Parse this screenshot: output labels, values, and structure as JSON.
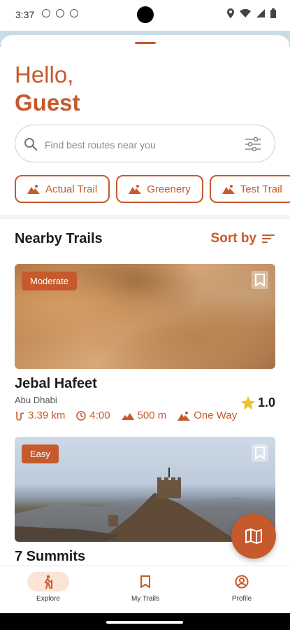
{
  "status_bar": {
    "time": "3:37"
  },
  "greeting": {
    "hello": "Hello,",
    "name": "Guest"
  },
  "search": {
    "placeholder": "Find best routes near you"
  },
  "chips": [
    {
      "label": "Actual Trail"
    },
    {
      "label": "Greenery"
    },
    {
      "label": "Test Trail"
    }
  ],
  "section": {
    "title": "Nearby Trails",
    "sort_label": "Sort by"
  },
  "trails": [
    {
      "badge": "Moderate",
      "name": "Jebal Hafeet",
      "location": "Abu Dhabi",
      "rating": "1.0",
      "distance": "3.39 km",
      "duration": "4:00",
      "elevation": "500 m",
      "route_type": "One Way"
    },
    {
      "badge": "Easy",
      "name": "7 Summits"
    }
  ],
  "nav": {
    "explore": "Explore",
    "my_trails": "My Trails",
    "profile": "Profile"
  },
  "colors": {
    "accent": "#c65a2c",
    "star": "#f2c230",
    "active_pill": "#fbe3d6"
  },
  "icons": [
    "search-icon",
    "filter-icon",
    "mountain-icon",
    "sort-icon",
    "bookmark-icon",
    "star-icon",
    "route-icon",
    "clock-icon",
    "elevation-icon",
    "map-icon",
    "hiker-icon",
    "profile-icon"
  ]
}
